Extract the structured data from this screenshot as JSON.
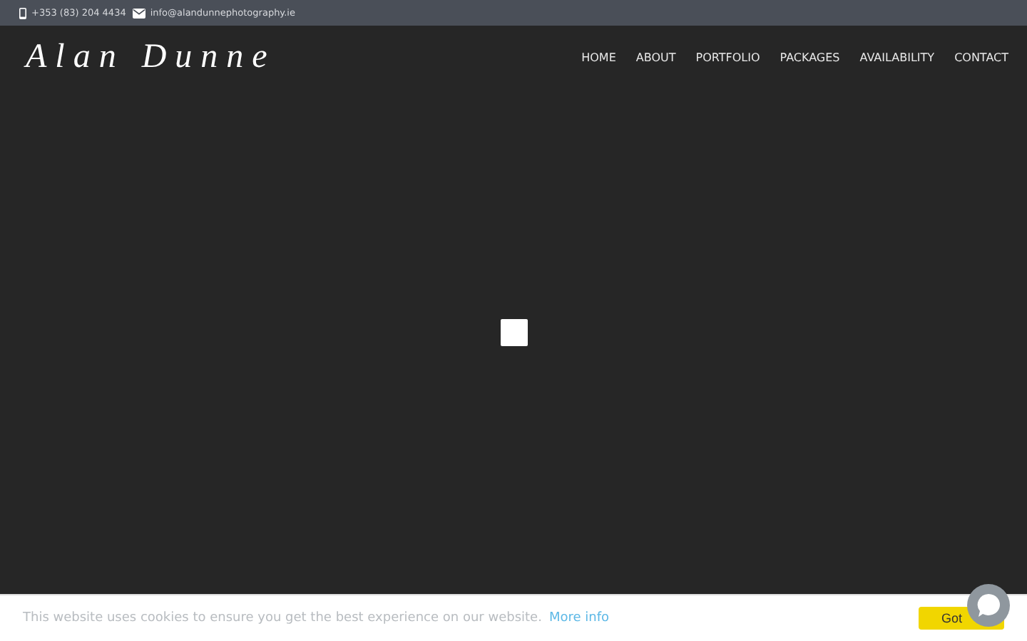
{
  "top_bar": {
    "phone": "+353 (83) 204 4434",
    "email": "info@alandunnephotography.ie"
  },
  "logo": "Alan Dunne",
  "nav": [
    {
      "label": "HOME"
    },
    {
      "label": "ABOUT"
    },
    {
      "label": "PORTFOLIO"
    },
    {
      "label": "PACKAGES"
    },
    {
      "label": "AVAILABILITY"
    },
    {
      "label": "CONTACT"
    }
  ],
  "cookie_bar": {
    "message": "This website uses cookies to ensure you get the best experience on our website.",
    "link": "More info",
    "button": "Got"
  }
}
